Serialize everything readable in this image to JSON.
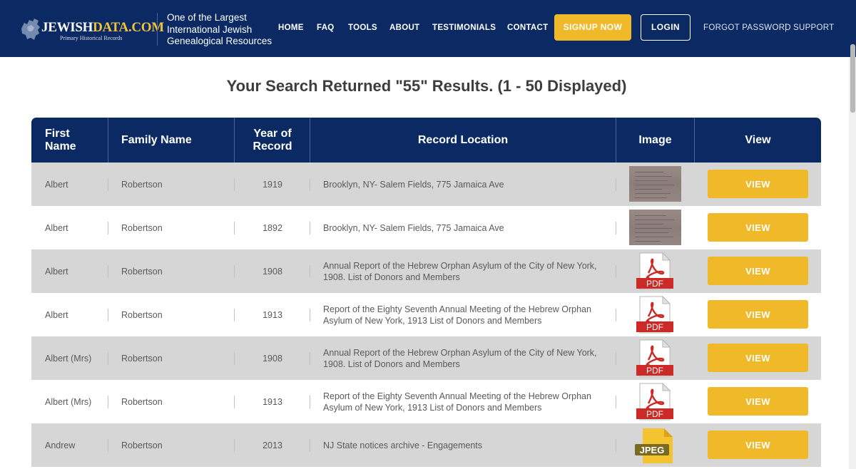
{
  "header": {
    "logo": {
      "brand_prefix": "JEWISH",
      "brand_suffix": "DATA.COM",
      "subtitle": "Primary Historical Records"
    },
    "tagline": "One of the Largest International Jewish Genealogical Resources",
    "nav": [
      "HOME",
      "FAQ",
      "TOOLS",
      "ABOUT",
      "TESTIMONIALS",
      "CONTACT"
    ],
    "signup_label": "SIGNUP NOW",
    "login_label": "LOGIN",
    "forgot_password": "FORGOT PASSWORD",
    "separator": "|",
    "support": "SUPPORT"
  },
  "results": {
    "title": "Your Search Returned \"55\" Results. (1 - 50 Displayed)",
    "columns": {
      "first_name": "First Name",
      "family_name": "Family Name",
      "year": "Year of Record",
      "location": "Record Location",
      "image": "Image",
      "view": "View"
    },
    "rows": [
      {
        "first": "Albert",
        "family": "Robertson",
        "year": "1919",
        "location": "Brooklyn, NY- Salem Fields, 775 Jamaica Ave",
        "image_type": "photo",
        "view": "VIEW"
      },
      {
        "first": "Albert",
        "family": "Robertson",
        "year": "1892",
        "location": "Brooklyn, NY- Salem Fields, 775 Jamaica Ave",
        "image_type": "photo",
        "view": "VIEW"
      },
      {
        "first": "Albert",
        "family": "Robertson",
        "year": "1908",
        "location": "Annual Report of the Hebrew Orphan Asylum of the City of New York, 1908. List of Donors and Members",
        "image_type": "pdf",
        "image_label": "PDF",
        "view": "VIEW"
      },
      {
        "first": "Albert",
        "family": "Robertson",
        "year": "1913",
        "location": "Report of the Eighty Seventh Annual Meeting of the Hebrew Orphan Asylum of New York, 1913 List of Donors and Members",
        "image_type": "pdf",
        "image_label": "PDF",
        "view": "VIEW"
      },
      {
        "first": "Albert (Mrs)",
        "family": "Robertson",
        "year": "1908",
        "location": "Annual Report of the Hebrew Orphan Asylum of the City of New York, 1908. List of Donors and Members",
        "image_type": "pdf",
        "image_label": "PDF",
        "view": "VIEW"
      },
      {
        "first": "Albert (Mrs)",
        "family": "Robertson",
        "year": "1913",
        "location": "Report of the Eighty Seventh Annual Meeting of the Hebrew Orphan Asylum of New York, 1913 List of Donors and Members",
        "image_type": "pdf",
        "image_label": "PDF",
        "view": "VIEW"
      },
      {
        "first": "Andrew",
        "family": "Robertson",
        "year": "2013",
        "location": "NJ State notices archive - Engagements",
        "image_type": "jpeg",
        "image_label": "JPEG",
        "view": "VIEW"
      }
    ]
  },
  "colors": {
    "navy": "#0b2a63",
    "gold": "#f0b929",
    "row_shade": "#d6d6d6",
    "pdf_red": "#cc2a27"
  }
}
